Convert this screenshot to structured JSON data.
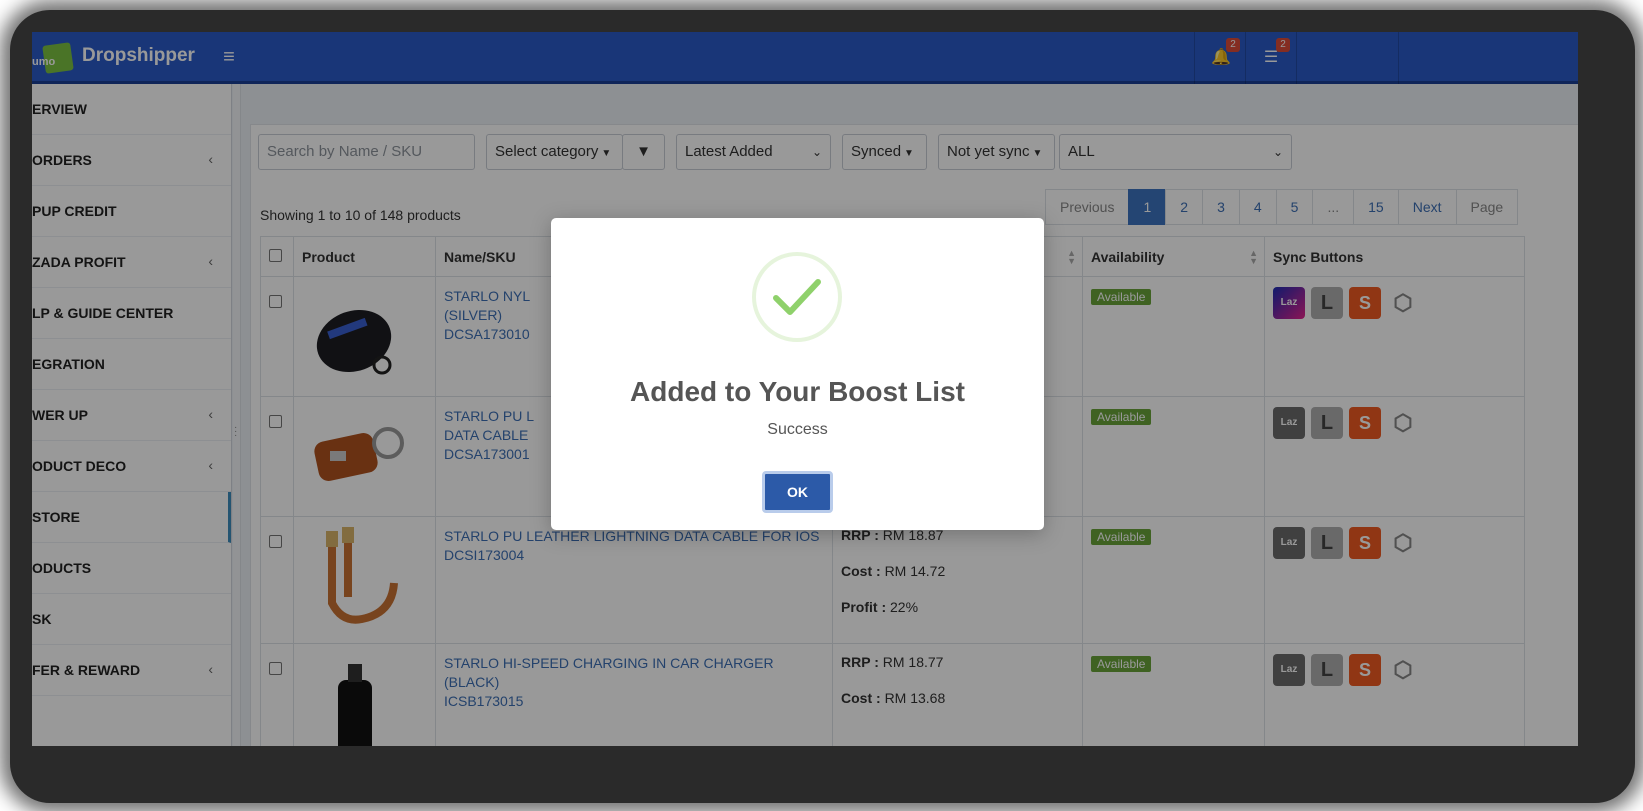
{
  "header": {
    "brand": "Dropshipper",
    "logo_text": "umo",
    "notifications_count": "2",
    "tasks_count": "2"
  },
  "sidebar": {
    "items": [
      {
        "label": "ERVIEW",
        "chevron": false,
        "active": false
      },
      {
        "label": " ORDERS",
        "chevron": true,
        "active": false
      },
      {
        "label": "PUP CREDIT",
        "chevron": false,
        "active": false
      },
      {
        "label": "ZADA PROFIT",
        "chevron": true,
        "active": false
      },
      {
        "label": "LP & GUIDE CENTER",
        "chevron": false,
        "active": false
      },
      {
        "label": "EGRATION",
        "chevron": false,
        "active": false
      },
      {
        "label": "WER UP",
        "chevron": true,
        "active": false
      },
      {
        "label": "ODUCT DECO",
        "chevron": true,
        "active": false
      },
      {
        "label": " STORE",
        "chevron": false,
        "active": true
      },
      {
        "label": "ODUCTS",
        "chevron": false,
        "active": false
      },
      {
        "label": "SK",
        "chevron": false,
        "active": false
      },
      {
        "label": "FER & REWARD",
        "chevron": true,
        "active": false
      }
    ]
  },
  "filters": {
    "search_placeholder": "Search by Name / SKU",
    "category": "Select category",
    "sort": "Latest Added",
    "synced": "Synced",
    "not_synced": "Not yet sync",
    "all": "ALL"
  },
  "listing": {
    "showing": "Showing 1 to 10 of 148 products"
  },
  "pagination": {
    "previous": "Previous",
    "pages": [
      "1",
      "2",
      "3",
      "4",
      "5",
      "...",
      "15"
    ],
    "next": "Next",
    "page": "Page",
    "active_page": "1"
  },
  "table": {
    "headers": {
      "product": "Product",
      "name_sku": "Name/SKU",
      "availability": "Availability",
      "sync_buttons": "Sync Buttons"
    },
    "rows": [
      {
        "name": "STARLO NYL",
        "name2": "(SILVER)",
        "sku": "DCSA173010",
        "rrp": "",
        "cost": "",
        "profit": "",
        "availability": "Available",
        "laz_active": true
      },
      {
        "name": "STARLO PU L",
        "name2": "DATA CABLE",
        "sku": "DCSA173001",
        "rrp": "",
        "cost": "",
        "profit": "",
        "availability": "Available",
        "laz_active": false
      },
      {
        "name": "STARLO PU LEATHER LIGHTNING DATA CABLE FOR IOS",
        "name2": "",
        "sku": "DCSI173004",
        "rrp": "RM 18.87",
        "cost": "RM 14.72",
        "profit": "22%",
        "availability": "Available",
        "laz_active": false
      },
      {
        "name": "STARLO HI-SPEED CHARGING IN CAR CHARGER (BLACK)",
        "name2": "",
        "sku": "ICSB173015",
        "rrp": "RM 18.77",
        "cost": "RM 13.68",
        "profit": "",
        "availability": "Available",
        "laz_active": false
      }
    ],
    "labels": {
      "rrp": "RRP :",
      "cost": "Cost :",
      "profit": "Profit :"
    }
  },
  "sync_labels": {
    "laz": "Laz",
    "lb": "L",
    "shop": "S",
    "hex": "⬡"
  },
  "modal": {
    "title": "Added to Your Boost List",
    "text": "Success",
    "ok": "OK"
  },
  "colors": {
    "header": "#2a5bc8",
    "accent": "#3c73c0",
    "success": "#6aa33a",
    "shopee": "#f15a22",
    "ok_button": "#2c5aa8"
  }
}
